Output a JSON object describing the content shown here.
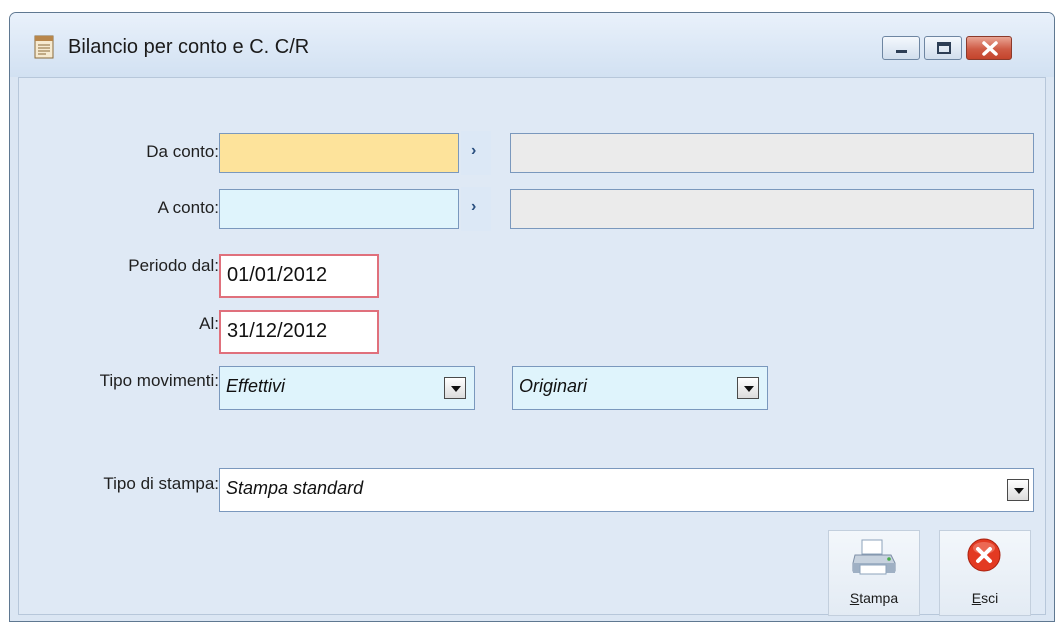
{
  "window": {
    "title": "Bilancio per conto e C. C/R"
  },
  "form": {
    "da_conto": {
      "label": "Da conto:",
      "value": "",
      "description": ""
    },
    "a_conto": {
      "label": "A conto:",
      "value": "",
      "description": ""
    },
    "periodo_dal": {
      "label": "Periodo dal:",
      "value": "01/01/2012"
    },
    "al": {
      "label": "Al:",
      "value": "31/12/2012"
    },
    "tipo_movimenti": {
      "label": "Tipo movimenti:",
      "value": "Effettivi",
      "value2": "Originari"
    },
    "tipo_stampa": {
      "label": "Tipo di stampa:",
      "value": "Stampa standard"
    }
  },
  "buttons": {
    "stampa": "Stampa",
    "esci": "Esci"
  },
  "icons": {
    "app": "report-document-icon",
    "zoom": "chevron-right-icon",
    "dropdown": "chevron-down-icon",
    "stampa": "printer-icon",
    "esci": "close-circle-icon"
  },
  "colors": {
    "required_field": "#fde39b",
    "input_field": "#dff4fc",
    "readonly_field": "#ebebeb",
    "date_border": "#e0707c",
    "close_button": "#cf5b45"
  }
}
